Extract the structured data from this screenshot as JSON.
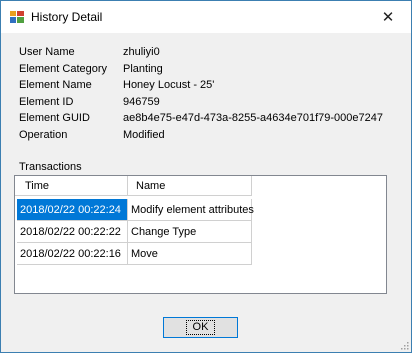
{
  "window": {
    "title": "History Detail",
    "close_glyph": "✕"
  },
  "info": [
    {
      "label": "User Name",
      "value": "zhuliyi0"
    },
    {
      "label": "Element Category",
      "value": "Planting"
    },
    {
      "label": "Element Name",
      "value": "Honey Locust - 25'"
    },
    {
      "label": "Element ID",
      "value": "946759"
    },
    {
      "label": "Element GUID",
      "value": "ae8b4e75-e47d-473a-8255-a4634e701f79-000e7247"
    },
    {
      "label": "Operation",
      "value": "Modified"
    }
  ],
  "transactions": {
    "label": "Transactions",
    "columns": [
      "Time",
      "Name"
    ],
    "rows": [
      {
        "time": "2018/02/22 00:22:24",
        "name": "Modify element attributes",
        "selected": true
      },
      {
        "time": "2018/02/22 00:22:22",
        "name": "Change Type",
        "selected": false
      },
      {
        "time": "2018/02/22 00:22:16",
        "name": "Move",
        "selected": false
      }
    ]
  },
  "buttons": {
    "ok_label": "OK"
  },
  "icons": {
    "app": "history-app-icon",
    "close": "close-icon",
    "grip": "resize-grip-icon"
  },
  "colors": {
    "selection": "#0078d7",
    "button_border": "#0078d7",
    "window_bg": "#f0f0f0"
  }
}
